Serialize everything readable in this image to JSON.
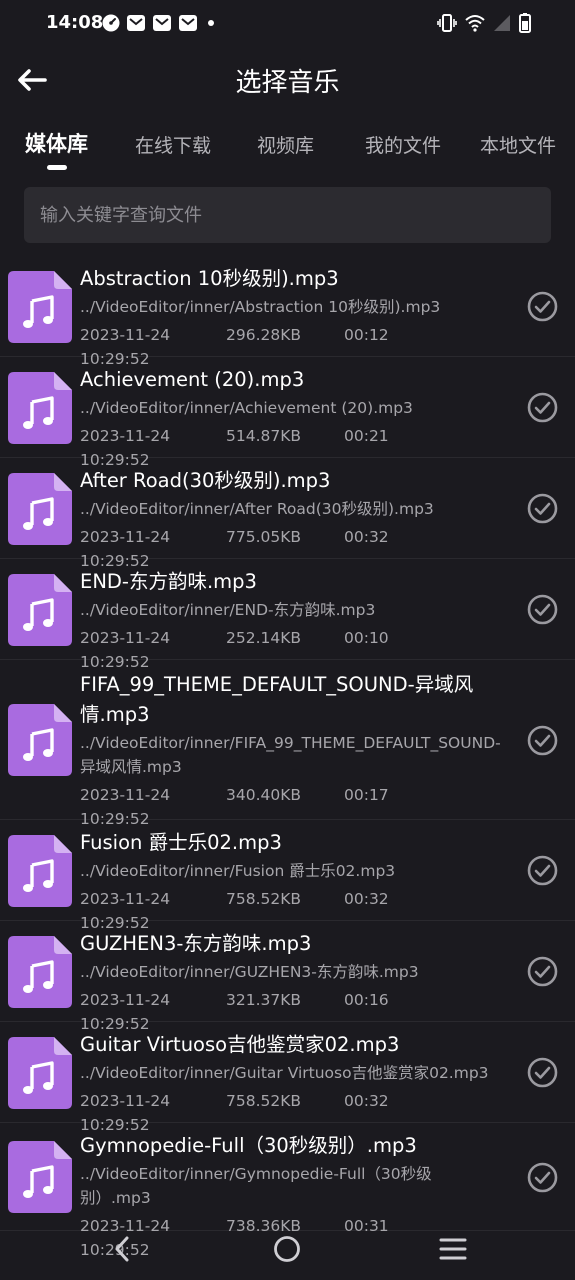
{
  "status_bar": {
    "time": "14:08",
    "left_icons": [
      "speed-icon",
      "mail-icon",
      "mail-icon",
      "mail-icon",
      "dot-icon"
    ],
    "right_icons": [
      "vibrate-icon",
      "wifi-icon",
      "signal-icon",
      "battery-icon"
    ]
  },
  "header": {
    "title": "选择音乐",
    "back_icon": "arrow-left-icon"
  },
  "tabs": [
    {
      "label": "媒体库",
      "active": true
    },
    {
      "label": "在线下载",
      "active": false
    },
    {
      "label": "视频库",
      "active": false
    },
    {
      "label": "我的文件",
      "active": false
    },
    {
      "label": "本地文件",
      "active": false
    }
  ],
  "search": {
    "placeholder": "输入关键字查询文件",
    "value": ""
  },
  "colors": {
    "background": "#1b1a1f",
    "icon_purple": "#a96be0",
    "icon_fold": "#d4b2f2",
    "muted_text": "#a7a6ab"
  },
  "files": [
    {
      "name": "Abstraction 10秒级别).mp3",
      "path": "../VideoEditor/inner/Abstraction 10秒级别).mp3",
      "date": "2023-11-24 10:29:52",
      "size": "296.28KB",
      "duration": "00:12"
    },
    {
      "name": "Achievement (20).mp3",
      "path": "../VideoEditor/inner/Achievement (20).mp3",
      "date": "2023-11-24 10:29:52",
      "size": "514.87KB",
      "duration": "00:21"
    },
    {
      "name": "After Road(30秒级别).mp3",
      "path": "../VideoEditor/inner/After Road(30秒级别).mp3",
      "date": "2023-11-24 10:29:52",
      "size": "775.05KB",
      "duration": "00:32"
    },
    {
      "name": "END-东方韵味.mp3",
      "path": "../VideoEditor/inner/END-东方韵味.mp3",
      "date": "2023-11-24 10:29:52",
      "size": "252.14KB",
      "duration": "00:10"
    },
    {
      "name": "FIFA_99_THEME_DEFAULT_SOUND-异域风情.mp3",
      "path": "../VideoEditor/inner/FIFA_99_THEME_DEFAULT_SOUND-异域风情.mp3",
      "date": "2023-11-24 10:29:52",
      "size": "340.40KB",
      "duration": "00:17"
    },
    {
      "name": "Fusion 爵士乐02.mp3",
      "path": "../VideoEditor/inner/Fusion 爵士乐02.mp3",
      "date": "2023-11-24 10:29:52",
      "size": "758.52KB",
      "duration": "00:32"
    },
    {
      "name": "GUZHEN3-东方韵味.mp3",
      "path": "../VideoEditor/inner/GUZHEN3-东方韵味.mp3",
      "date": "2023-11-24 10:29:52",
      "size": "321.37KB",
      "duration": "00:16"
    },
    {
      "name": "Guitar Virtuoso吉他鉴赏家02.mp3",
      "path": "../VideoEditor/inner/Guitar Virtuoso吉他鉴赏家02.mp3",
      "date": "2023-11-24 10:29:52",
      "size": "758.52KB",
      "duration": "00:32"
    },
    {
      "name": "Gymnopedie-Full（30秒级别）.mp3",
      "path": "../VideoEditor/inner/Gymnopedie-Full（30秒级别）.mp3",
      "date": "2023-11-24 10:29:52",
      "size": "738.36KB",
      "duration": "00:31"
    }
  ],
  "nav_bar": {
    "icons": [
      "nav-back-icon",
      "nav-home-icon",
      "nav-menu-icon"
    ]
  }
}
